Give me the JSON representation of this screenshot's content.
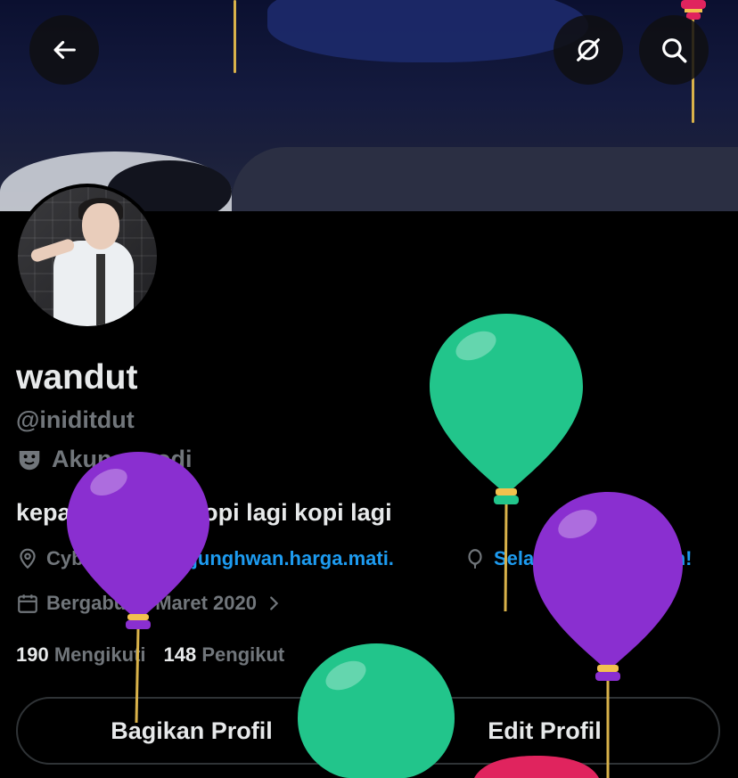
{
  "header": {
    "back_icon": "arrow-left-icon",
    "grok_icon": "grok-icon",
    "search_icon": "search-icon"
  },
  "profile": {
    "display_name": "wandut",
    "handle": "@iniditdut",
    "badge_icon": "theater-mask-icon",
    "badge_label": "Akun parodi",
    "bio": "kepala pundak kopi lagi kopi lagi",
    "location": "Cyber",
    "link": "so.junghwan.harga.mati.",
    "birthday": "Selamat ulang tahun!",
    "joined": "Bergabung Maret 2020"
  },
  "stats": {
    "following_count": "190",
    "following_label": "Mengikuti",
    "followers_count": "148",
    "followers_label": "Pengikut"
  },
  "actions": {
    "share_label": "Bagikan Profil",
    "edit_label": "Edit Profil"
  },
  "colors": {
    "background": "#000000",
    "text_primary": "#e7e9ea",
    "text_secondary": "#71767b",
    "link": "#1d9bf0",
    "balloon_green": "#22c58b",
    "balloon_purple": "#8a2fd0",
    "balloon_red": "#e0245e"
  }
}
